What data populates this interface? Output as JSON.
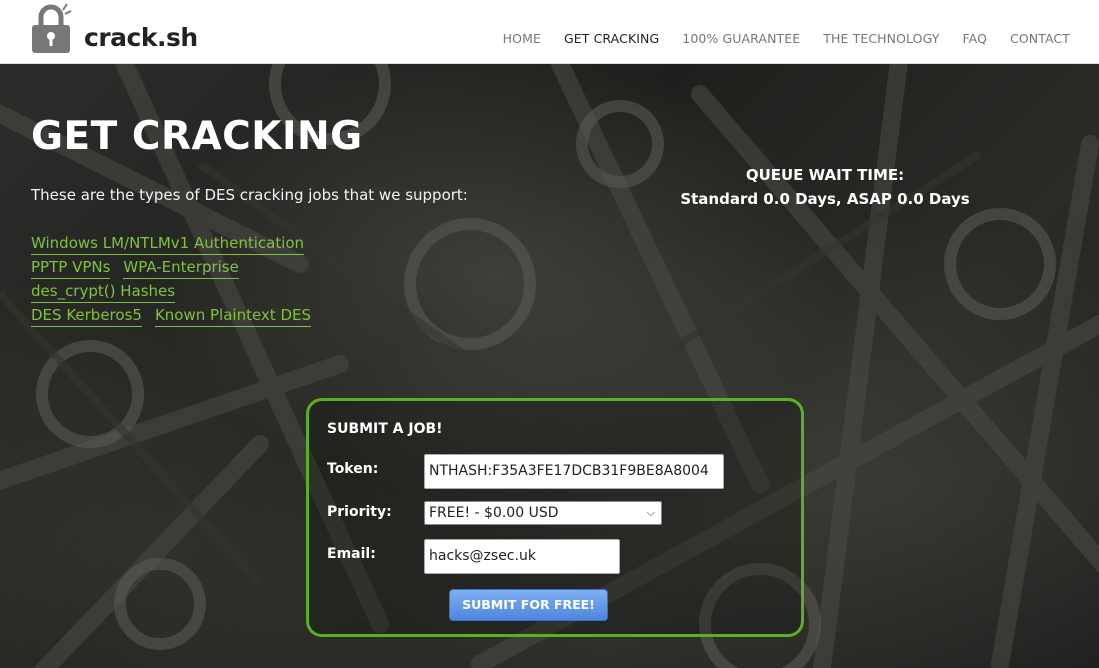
{
  "header": {
    "brand": "crack.sh",
    "nav": [
      "HOME",
      "GET CRACKING",
      "100% GUARANTEE",
      "THE TECHNOLOGY",
      "FAQ",
      "CONTACT"
    ],
    "active_nav": "GET CRACKING"
  },
  "main": {
    "title": "GET CRACKING",
    "intro": "These are the types of DES cracking jobs that we support:",
    "queue": {
      "label": "QUEUE WAIT TIME:",
      "value": "Standard 0.0 Days, ASAP 0.0 Days"
    },
    "job_links": [
      [
        "Windows LM/NTLMv1 Authentication"
      ],
      [
        "PPTP VPNs",
        "WPA-Enterprise"
      ],
      [
        "des_crypt() Hashes"
      ],
      [
        "DES Kerberos5",
        "Known Plaintext DES"
      ]
    ]
  },
  "form": {
    "title": "SUBMIT A JOB!",
    "token_label": "Token:",
    "token_value": "NTHASH:F35A3FE17DCB31F9BE8A8004",
    "priority_label": "Priority:",
    "priority_value": "FREE! - $0.00 USD",
    "email_label": "Email:",
    "email_value": "hacks@zsec.uk",
    "submit_label": "SUBMIT FOR FREE!"
  },
  "colors": {
    "accent_green": "#7dc43a",
    "panel_border": "#5ab01f",
    "button_blue": "#4e86de"
  },
  "icons": [
    "lock-icon",
    "chevron-down-icon"
  ]
}
